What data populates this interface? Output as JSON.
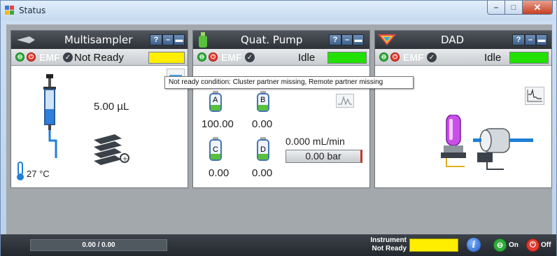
{
  "window": {
    "title": "Status",
    "controls": {
      "minimize": "–",
      "maximize": "□",
      "close": "✕"
    }
  },
  "tooltip": "Not ready condition: Cluster partner missing, Remote partner missing",
  "modules": {
    "multisampler": {
      "title": "Multisampler",
      "help": "?",
      "emf": "EMF",
      "state": "Not Ready",
      "state_color": "#ffee00",
      "volume": "5.00 µL",
      "temperature": "27 °C"
    },
    "pump": {
      "title": "Quat. Pump",
      "help": "?",
      "emf": "EMF",
      "state": "Idle",
      "state_color": "#22e000",
      "bottles": [
        {
          "letter": "A",
          "value": "100.00"
        },
        {
          "letter": "B",
          "value": "0.00"
        },
        {
          "letter": "C",
          "value": "0.00"
        },
        {
          "letter": "D",
          "value": "0.00"
        }
      ],
      "flow": "0.000 mL/min",
      "pressure": "0.00 bar"
    },
    "dad": {
      "title": "DAD",
      "help": "?",
      "emf": "EMF",
      "state": "Idle",
      "state_color": "#22e000"
    }
  },
  "bottom": {
    "progress": "0.00 / 0.00",
    "instrument_label_1": "Instrument",
    "instrument_label_2": "Not Ready",
    "instrument_color": "#ffee00",
    "info": "i",
    "on_label": "On",
    "off_label": "Off"
  },
  "icons": {
    "app": "status-app-icon",
    "power_on": "power-on-icon",
    "power_off": "power-off-icon",
    "check": "check-icon",
    "syringe": "syringe-icon",
    "thermometer": "thermometer-icon",
    "trays": "sample-tray-icon",
    "lamp": "lamp-icon",
    "detector": "flow-cell-icon"
  }
}
